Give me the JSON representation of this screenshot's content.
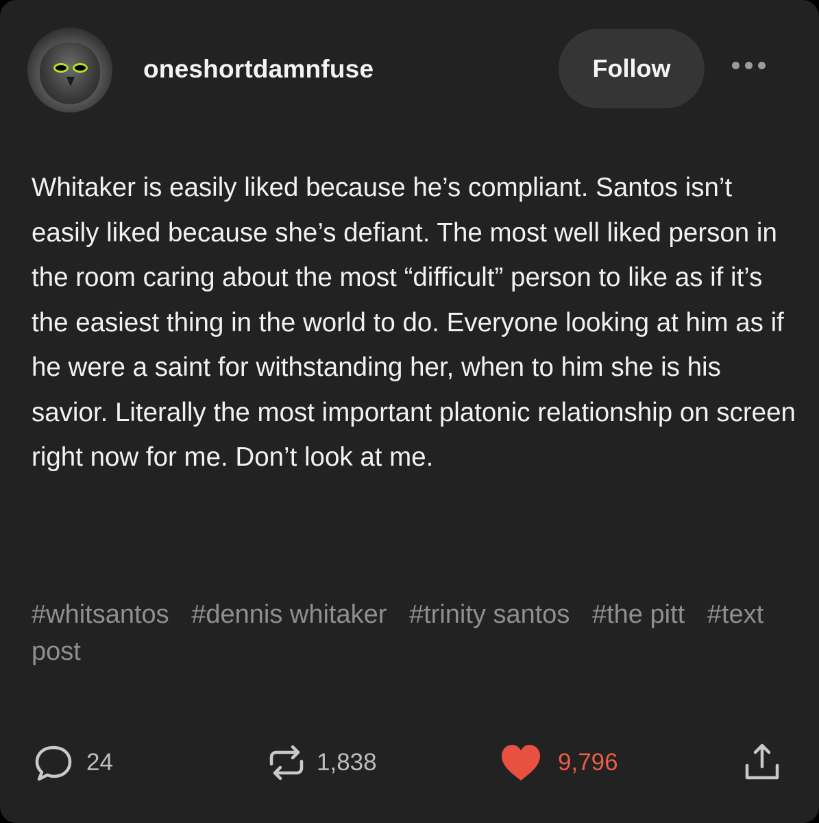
{
  "post": {
    "username": "oneshortdamnfuse",
    "follow_label": "Follow",
    "more_icon": "more-horizontal-icon",
    "body": "Whitaker is easily liked because he’s compliant. Santos isn’t easily liked because she’s defiant. The most well liked person in the room caring about the most “difficult” person to like as if it’s the easiest thing in the world to do. Everyone looking at him as if he were a saint for withstanding her, when to him she is his savior. Literally the most important platonic relationship on screen right now for me. Don’t look at me.",
    "tags": [
      "#whitsantos",
      "#dennis whitaker",
      "#trinity santos",
      "#the pitt",
      "#text post"
    ]
  },
  "footer": {
    "comments": "24",
    "reblogs": "1,838",
    "likes": "9,796",
    "icons": {
      "comment": "comment-bubble-icon",
      "reblog": "reblog-icon",
      "like": "heart-icon",
      "share": "share-icon"
    }
  },
  "colors": {
    "card_background": "#222222",
    "follow_button": "#353535",
    "tag_text": "#8f8f8f",
    "like_accent": "#ea5c45",
    "avatar_eyes": "#b7e11f"
  }
}
